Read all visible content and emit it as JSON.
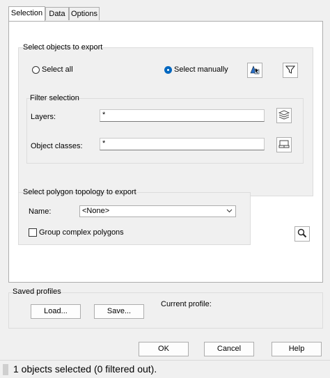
{
  "tabs": [
    "Selection",
    "Data",
    "Options"
  ],
  "export_group": {
    "title": "Select objects to export",
    "select_all": "Select all",
    "select_manually": "Select manually",
    "selected": "select_manually"
  },
  "filter_group": {
    "title": "Filter selection",
    "layers_label": "Layers:",
    "layers_value": "*",
    "classes_label": "Object classes:",
    "classes_value": "*"
  },
  "topology_group": {
    "title": "Select polygon topology to export",
    "name_label": "Name:",
    "name_value": "<None>",
    "group_complex": "Group complex polygons",
    "group_complex_checked": false
  },
  "profiles": {
    "title": "Saved profiles",
    "load": "Load...",
    "save": "Save...",
    "current_label": "Current profile:"
  },
  "dialog_buttons": {
    "ok": "OK",
    "cancel": "Cancel",
    "help": "Help"
  },
  "status": "1 objects selected (0 filtered out)."
}
